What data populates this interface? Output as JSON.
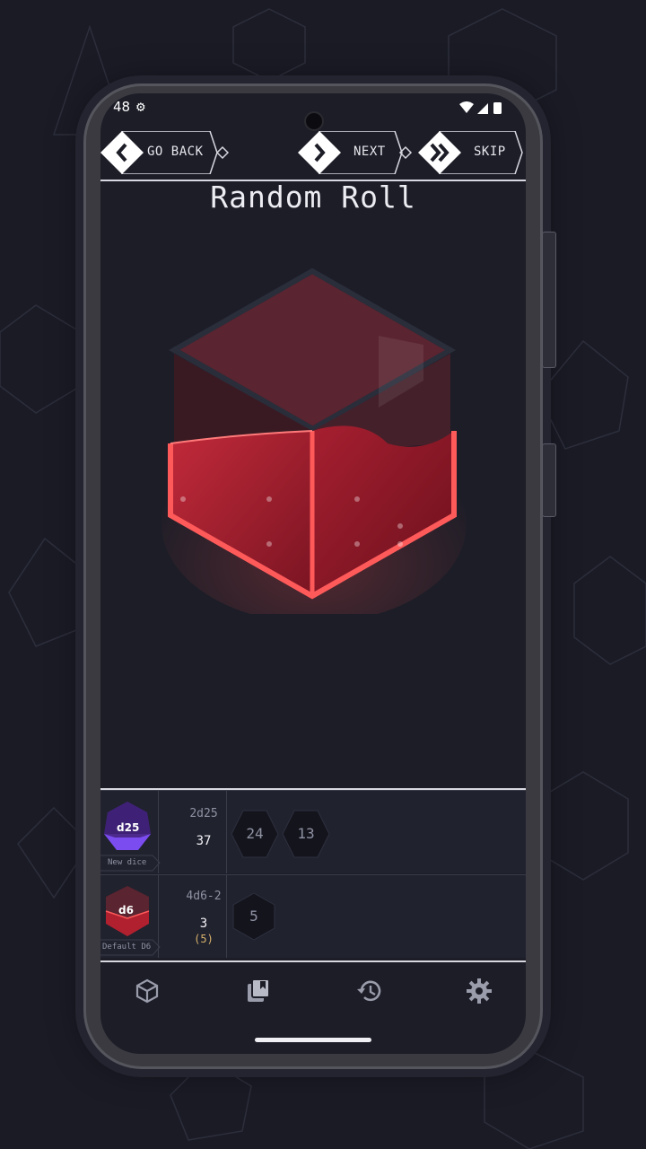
{
  "status": {
    "time": "48",
    "gear_icon": "gear-icon"
  },
  "nav": {
    "back_label": "GO BACK",
    "next_label": "NEXT",
    "skip_label": "SKIP"
  },
  "title": "Random Roll",
  "colors": {
    "accent_red": "#ff5a5a",
    "dice_red": "#8e1c2a",
    "purple": "#5b2bbf",
    "bg": "#1c1d27"
  },
  "rolls": [
    {
      "die_label": "d25",
      "die_name": "New dice",
      "formula": "2d25",
      "total": "37",
      "raw": "",
      "results": [
        "24",
        "13"
      ]
    },
    {
      "die_label": "d6",
      "die_name": "Default D6",
      "formula": "4d6-2",
      "total": "3",
      "raw": "(5)",
      "results": [
        "5"
      ]
    }
  ],
  "tabs": [
    "dice-icon",
    "library-icon",
    "history-icon",
    "settings-icon"
  ]
}
